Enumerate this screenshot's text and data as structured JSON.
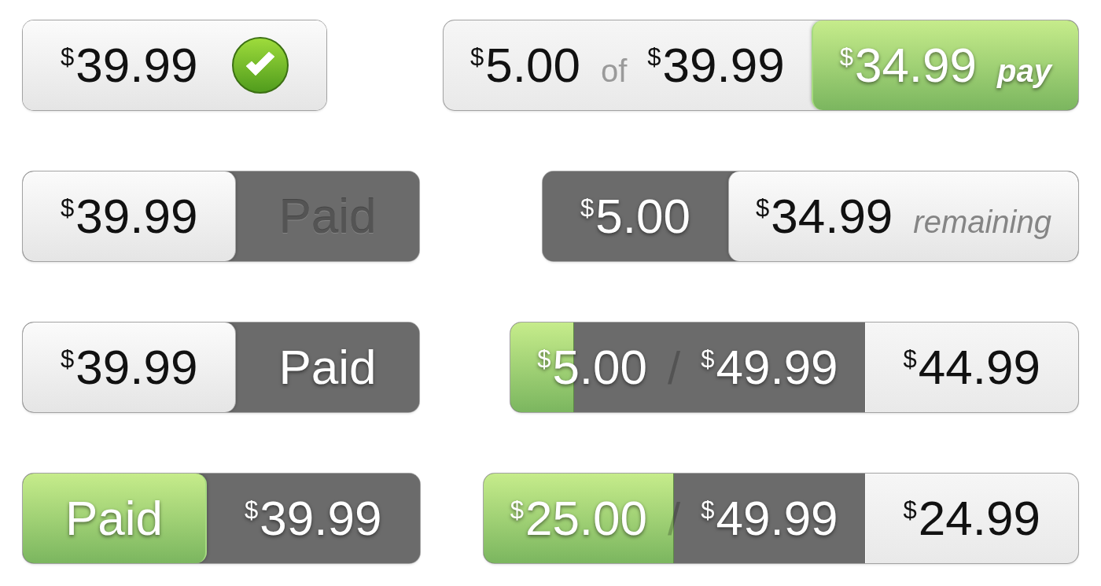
{
  "tags": [
    {
      "checked": true,
      "segments": [
        {
          "kind": "raised",
          "items": [
            {
              "kind": "amount",
              "text": "$^{$}$39.99"
            }
          ]
        }
      ]
    },
    {
      "checked": false,
      "segments": [
        {
          "kind": "flat",
          "items": [
            {
              "kind": "amount",
              "text": "$^{$}$5.00"
            },
            {
              "kind": "connector",
              "text": "of"
            },
            {
              "kind": "amount",
              "text": "$^{$}$39.99"
            }
          ]
        },
        {
          "kind": "accent",
          "items": [
            {
              "kind": "amount",
              "text": "$^{$}$34.99"
            },
            {
              "kind": "action",
              "text": "pay"
            }
          ]
        }
      ]
    },
    {
      "checked": false,
      "segments": [
        {
          "kind": "raised",
          "items": [
            {
              "kind": "amount",
              "text": "$^{$}$39.99"
            }
          ]
        },
        {
          "kind": "dark",
          "items": [
            {
              "kind": "status",
              "text": "Paid",
              "disabled": true
            }
          ]
        }
      ]
    },
    {
      "checked": false,
      "segments": [
        {
          "kind": "dark",
          "items": [
            {
              "kind": "amount",
              "text": "$^{$}$5.00"
            }
          ]
        },
        {
          "kind": "raised",
          "items": [
            {
              "kind": "amount",
              "text": "$^{$}$34.99"
            },
            {
              "kind": "note",
              "text": "remaining"
            }
          ]
        }
      ]
    },
    {
      "checked": false,
      "segments": [
        {
          "kind": "raised",
          "items": [
            {
              "kind": "amount",
              "text": "$^{$}$39.99"
            }
          ]
        },
        {
          "kind": "dark",
          "items": [
            {
              "kind": "status",
              "text": "Paid",
              "disabled": false
            }
          ]
        }
      ]
    },
    {
      "checked": false,
      "segments": [
        {
          "kind": "progress",
          "level": 0.18,
          "items": [
            {
              "kind": "amount",
              "text": "$^{$}$5.00"
            },
            {
              "kind": "separator",
              "text": "/"
            },
            {
              "kind": "amount",
              "text": "$^{$}$49.99"
            }
          ]
        },
        {
          "kind": "flat",
          "items": [
            {
              "kind": "amount",
              "text": "$^{$}$44.99"
            }
          ]
        }
      ]
    },
    {
      "checked": false,
      "segments": [
        {
          "kind": "accent",
          "items": [
            {
              "kind": "status",
              "text": "Paid",
              "disabled": false
            }
          ]
        },
        {
          "kind": "dark",
          "items": [
            {
              "kind": "amount",
              "text": "$^{$}$39.99"
            }
          ]
        }
      ]
    },
    {
      "checked": false,
      "segments": [
        {
          "kind": "progress",
          "level": 0.5,
          "items": [
            {
              "kind": "amount",
              "text": "$^{$}$25.00"
            },
            {
              "kind": "separator",
              "text": "/"
            },
            {
              "kind": "amount",
              "text": "$^{$}$49.99"
            }
          ]
        },
        {
          "kind": "flat",
          "items": [
            {
              "kind": "amount",
              "text": "$^{$}$24.99"
            }
          ]
        }
      ]
    }
  ]
}
